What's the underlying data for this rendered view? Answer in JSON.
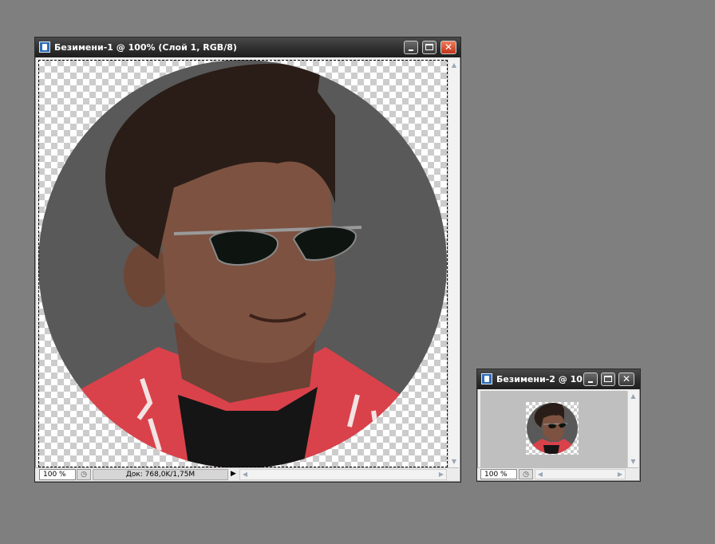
{
  "documents": [
    {
      "title": "Безимени-1 @ 100% (Слой 1, RGB/8)",
      "zoom": "100 %",
      "doc_info": "Док: 768,0K/1,75M",
      "play_arrow": "▶"
    },
    {
      "title": "Безимени-2 @ 10...",
      "zoom": "100 %"
    }
  ],
  "icons": {
    "app": "photoshop-document-icon",
    "minimize": "minimize-icon",
    "maximize": "maximize-icon",
    "close": "close-icon",
    "nav": "navigator-icon",
    "up": "▲",
    "down": "▼",
    "left": "◀",
    "right": "▶"
  },
  "colors": {
    "workspace": "#7f7f7f",
    "circle_gray": "#595959",
    "shirt_red": "#d9424a",
    "close_button": "#d2472a"
  }
}
